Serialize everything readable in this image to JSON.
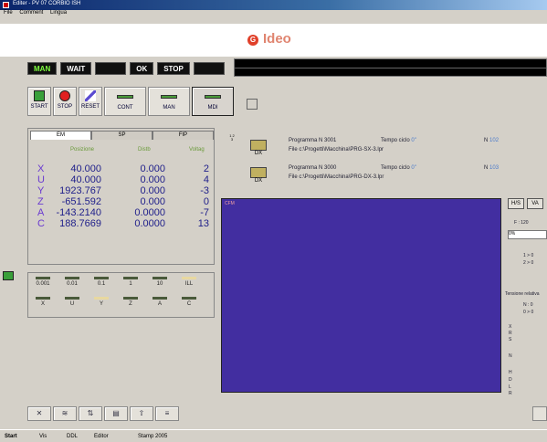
{
  "window": {
    "title": "Editer - PV 07 CORBIO ISH",
    "menu": [
      "File",
      "Comment",
      "Lingua"
    ]
  },
  "brand": {
    "logo_letter": "G",
    "name": "Ideo"
  },
  "status": [
    "MAN",
    "WAIT",
    "",
    "OK",
    "STOP",
    ""
  ],
  "toolbar": [
    {
      "label": "START",
      "icon": "start-icon"
    },
    {
      "label": "STOP",
      "icon": "stop-icon"
    },
    {
      "label": "RESET",
      "icon": "reset-icon"
    },
    {
      "label": "CONT",
      "icon": "cont-icon"
    },
    {
      "label": "MAN",
      "icon": "man-icon"
    },
    {
      "label": "MDI",
      "icon": "mdi-icon"
    }
  ],
  "tabs": [
    "EM",
    "SP",
    "FIP"
  ],
  "axis_headers": [
    "Posizione",
    "Distb",
    "Voltag"
  ],
  "axes": [
    {
      "name": "X",
      "pos": "40.000",
      "dist": "0.000",
      "err": "2"
    },
    {
      "name": "U",
      "pos": "40.000",
      "dist": "0.000",
      "err": "4"
    },
    {
      "name": "Y",
      "pos": "1923.767",
      "dist": "0.000",
      "err": "-3"
    },
    {
      "name": "Z",
      "pos": "-651.592",
      "dist": "0.000",
      "err": "0"
    },
    {
      "name": "A",
      "pos": "-143.2140",
      "dist": "0.0000",
      "err": "-7"
    },
    {
      "name": "C",
      "pos": "188.7669",
      "dist": "0.0000",
      "err": "13"
    }
  ],
  "jog_steps": [
    "0.001",
    "0.01",
    "0.1",
    "1",
    "10",
    "ILL"
  ],
  "jog_axes": [
    "X",
    "U",
    "Y",
    "Z",
    "A",
    "C"
  ],
  "programs": [
    {
      "side": "1 2 3",
      "folder": "DX",
      "name": "Programma N 3001",
      "file": "File  c:\\Progetti\\Macchina\\PRG-SX-3.lpr",
      "time_label": "Tempo ciclo",
      "time": "0\"",
      "n_label": "N",
      "n": "102"
    },
    {
      "side": "",
      "folder": "DX",
      "name": "Programma N 3000",
      "file": "File  c:\\Progetti\\Macchina\\PRG-DX-3.lpr",
      "time_label": "Tempo ciclo",
      "time": "0\"",
      "n_label": "N",
      "n": "103"
    }
  ],
  "canvas": {
    "label": "CFM"
  },
  "side_panel": {
    "btn1": "H/S",
    "btn2": "VA",
    "f_label": "F : 120",
    "f_val": "0%",
    "line1": "1 > 0",
    "line2": "2 > 0",
    "rel": "Tensione relativa",
    "r1": "N : 0",
    "r2": "0 > 0",
    "r_labels": [
      "X",
      "R",
      "S",
      "N",
      "H",
      "D",
      "L",
      "R"
    ]
  },
  "bottom_tools": [
    "✕",
    "≋",
    "⇅",
    "▤",
    "⇧",
    "≡"
  ],
  "taskbar": {
    "start": "Start",
    "items": [
      "Vis",
      "DDL",
      "Editor",
      "Stamp 2005"
    ]
  }
}
